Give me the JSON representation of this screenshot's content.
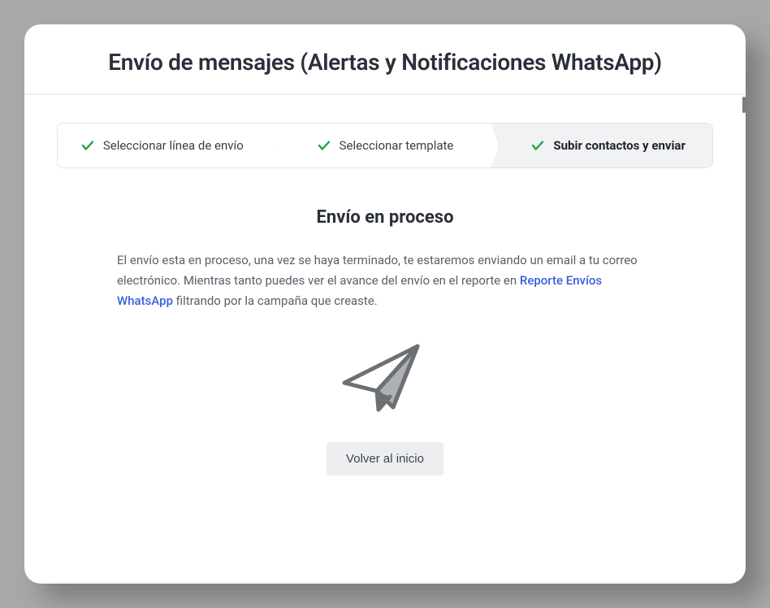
{
  "header": {
    "title": "Envío de mensajes (Alertas y Notificaciones WhatsApp)"
  },
  "steps": [
    {
      "label": "Seleccionar línea de envío",
      "done": true,
      "active": false
    },
    {
      "label": "Seleccionar template",
      "done": true,
      "active": false
    },
    {
      "label": "Subir contactos y enviar",
      "done": true,
      "active": true
    }
  ],
  "status": {
    "title": "Envío en proceso",
    "desc_pre": "El envío esta en proceso, una vez se haya terminado, te estaremos enviando un email a tu correo electrónico. Mientras tanto puedes ver el avance del envío en el reporte en ",
    "link_text": "Reporte Envíos WhatsApp",
    "desc_post": " filtrando por la campaña que creaste."
  },
  "actions": {
    "back_label": "Volver al inicio"
  },
  "colors": {
    "check_green": "#1fa53a",
    "icon_gray": "#6b7075"
  }
}
